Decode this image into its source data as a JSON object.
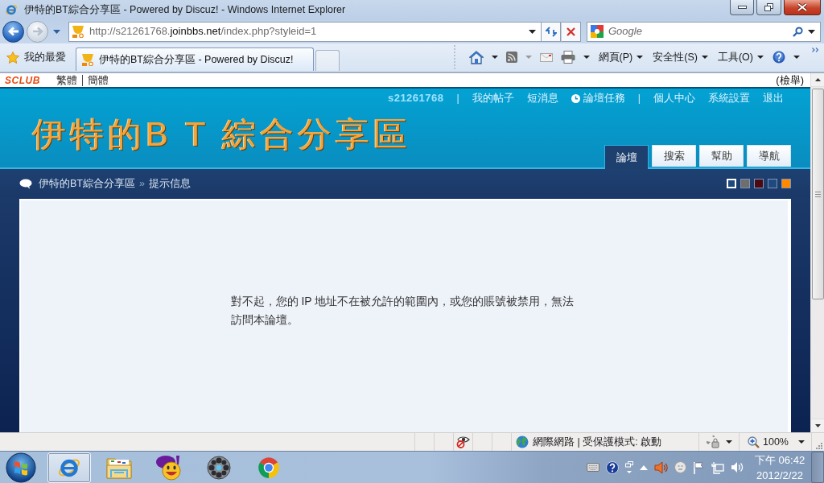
{
  "window": {
    "title": "伊特的BT綜合分享區 - Powered by Discuz! - Windows Internet Explorer"
  },
  "address_bar": {
    "url": [
      {
        "kind": "dim",
        "text": "http://s21261768."
      },
      {
        "kind": "domain",
        "text": "joinbbs.net"
      },
      {
        "kind": "dim",
        "text": "/index.php?styleid=1"
      }
    ]
  },
  "search": {
    "placeholder": "Google"
  },
  "favorites": {
    "label": "我的最愛"
  },
  "tabs": [
    {
      "label": "伊特的BT綜合分享區 - Powered by Discuz!",
      "selected": true
    }
  ],
  "command_bar": {
    "menus": [
      "網頁(P)",
      "安全性(S)",
      "工具(O)"
    ]
  },
  "page": {
    "top_bar": {
      "logo": "SCLUB",
      "languages": [
        "繁體",
        "簡體"
      ],
      "report": "(檢舉)"
    },
    "user_links": [
      {
        "kind": "user",
        "label": "s21261768"
      },
      {
        "kind": "separator",
        "label": "|"
      },
      {
        "kind": "link",
        "label": "我的帖子"
      },
      {
        "kind": "link",
        "label": "短消息"
      },
      {
        "kind": "task",
        "label": "論壇任務"
      },
      {
        "kind": "separator",
        "label": "|"
      },
      {
        "kind": "link",
        "label": "個人中心"
      },
      {
        "kind": "link",
        "label": "系統設置"
      },
      {
        "kind": "link",
        "label": "退出"
      }
    ],
    "site_logo": "伊特的B T 綜合分享區",
    "nav_tabs": [
      {
        "label": "論壇",
        "selected": true
      },
      {
        "label": "搜索",
        "selected": false
      },
      {
        "label": "幫助",
        "selected": false
      },
      {
        "label": "導航",
        "selected": false
      }
    ],
    "breadcrumb": [
      {
        "kind": "link",
        "text": "伊特的BT綜合分享區"
      },
      {
        "kind": "separator",
        "text": "»"
      },
      {
        "kind": "current",
        "text": "提示信息"
      }
    ],
    "style_swatches": [
      {
        "color": "#1f4a7f",
        "selected": true
      },
      {
        "color": "#6e6e6e",
        "selected": false
      },
      {
        "color": "#4b0a12",
        "selected": false
      },
      {
        "color": "#1f4a7f",
        "selected": false
      },
      {
        "color": "#ff8a00",
        "selected": false
      }
    ],
    "message": "對不起，您的 IP 地址不在被允許的範圍內，或您的賬號被禁用，無法訪問本論壇。"
  },
  "status_bar": {
    "zone": "網際網路 | 受保護模式: 啟動",
    "zoom": "100%"
  },
  "taskbar": {
    "apps": [
      {
        "kind": "browser",
        "selected": true
      },
      {
        "kind": "folder",
        "selected": false
      },
      {
        "kind": "messenger",
        "selected": false
      },
      {
        "kind": "media",
        "selected": false
      },
      {
        "kind": "web",
        "selected": false
      }
    ],
    "clock": {
      "time": "下午 06:42",
      "date": "2012/2/22"
    }
  }
}
